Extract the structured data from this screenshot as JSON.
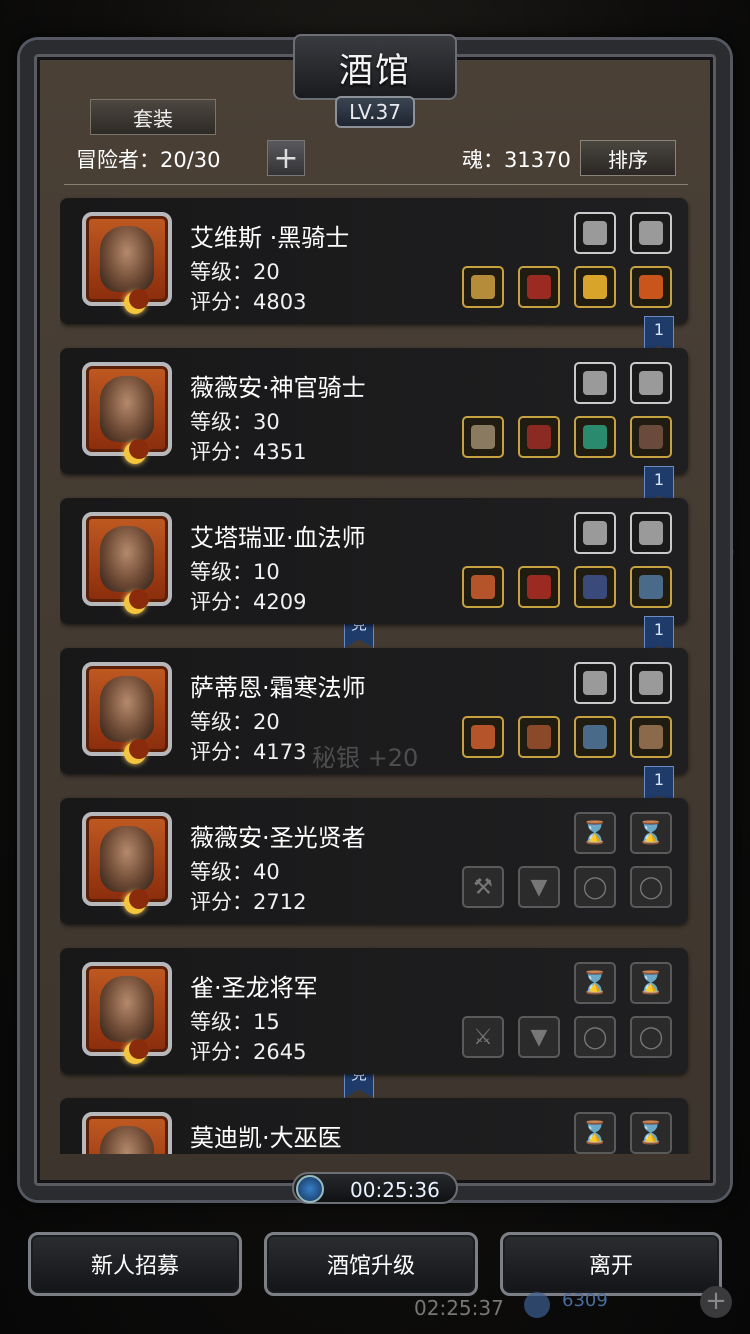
{
  "header": {
    "title": "酒馆",
    "level": "LV.37",
    "set_tab": "套装",
    "adventurers_label": "冒险者：20/30",
    "plus_glyph": "+",
    "soul_label": "魂：31370",
    "sort_label": "排序"
  },
  "heroes": [
    {
      "name": "艾维斯 ·黑骑士",
      "level": "等级：20",
      "score": "评分：4803",
      "top_slots": [
        {
          "type": "eq",
          "icon": "bracer-icon"
        },
        {
          "type": "eq",
          "icon": "bracer-icon"
        }
      ],
      "bottom_slots": [
        {
          "type": "gold",
          "icon": "crossbow-icon",
          "color": "#b58d3a"
        },
        {
          "type": "gold",
          "icon": "helmet-icon",
          "color": "#9a2a22"
        },
        {
          "type": "gold",
          "icon": "ring-icon",
          "color": "#d8a52a"
        },
        {
          "type": "gold",
          "icon": "ring-icon",
          "color": "#c9551d"
        }
      ],
      "ribbon": "1"
    },
    {
      "name": "薇薇安·神官骑士",
      "level": "等级：30",
      "score": "评分：4351",
      "top_slots": [
        {
          "type": "eq",
          "icon": "amulet-icon"
        },
        {
          "type": "eq",
          "icon": "mask-icon"
        }
      ],
      "bottom_slots": [
        {
          "type": "gold",
          "icon": "axe-icon",
          "color": "#8a7a60"
        },
        {
          "type": "gold",
          "icon": "armor-icon",
          "color": "#8b2a22"
        },
        {
          "type": "gold",
          "icon": "gem-icon",
          "color": "#2a8a6e"
        },
        {
          "type": "gold",
          "icon": "cloak-icon",
          "color": "#6a4a3a"
        }
      ],
      "ribbon": "1",
      "badge": "竞"
    },
    {
      "name": "艾塔瑞亚·血法师",
      "level": "等级：10",
      "score": "评分：4209",
      "top_slots": [
        {
          "type": "eq",
          "icon": "book-icon"
        },
        {
          "type": "eq",
          "icon": "wand-icon"
        }
      ],
      "bottom_slots": [
        {
          "type": "gold",
          "icon": "staff-icon",
          "color": "#b5532a"
        },
        {
          "type": "gold",
          "icon": "helmet-icon",
          "color": "#9a2a22"
        },
        {
          "type": "gold",
          "icon": "amulet-icon",
          "color": "#3a4a7a"
        },
        {
          "type": "gold",
          "icon": "armor-icon",
          "color": "#4a6a8a"
        }
      ],
      "ribbon": "1"
    },
    {
      "name": "萨蒂恩·霜寒法师",
      "level": "等级：20",
      "score": "评分：4173",
      "top_slots": [
        {
          "type": "eq",
          "icon": "shield-icon"
        },
        {
          "type": "eq",
          "icon": "horn-icon"
        }
      ],
      "bottom_slots": [
        {
          "type": "gold",
          "icon": "staff-icon",
          "color": "#b5532a"
        },
        {
          "type": "gold",
          "icon": "robe-icon",
          "color": "#8a4a2a"
        },
        {
          "type": "gold",
          "icon": "armor-icon",
          "color": "#4a6a8a"
        },
        {
          "type": "gold",
          "icon": "gauntlet-icon",
          "color": "#8a6a4a"
        }
      ],
      "ribbon": "1"
    },
    {
      "name": "薇薇安·圣光贤者",
      "level": "等级：40",
      "score": "评分：2712",
      "top_slots": [
        {
          "type": "empty",
          "icon": "hourglass-icon"
        },
        {
          "type": "empty",
          "icon": "hourglass-icon"
        }
      ],
      "bottom_slots": [
        {
          "type": "empty",
          "icon": "hammer-icon"
        },
        {
          "type": "empty",
          "icon": "armor-icon"
        },
        {
          "type": "empty",
          "icon": "ring-icon"
        },
        {
          "type": "empty",
          "icon": "ring-icon"
        }
      ],
      "badge": "竞"
    },
    {
      "name": "雀·圣龙将军",
      "level": "等级：15",
      "score": "评分：2645",
      "top_slots": [
        {
          "type": "empty",
          "icon": "hourglass-icon"
        },
        {
          "type": "empty",
          "icon": "hourglass-icon"
        }
      ],
      "bottom_slots": [
        {
          "type": "empty",
          "icon": "sword-icon"
        },
        {
          "type": "empty",
          "icon": "armor-icon"
        },
        {
          "type": "empty",
          "icon": "ring-icon"
        },
        {
          "type": "empty",
          "icon": "ring-icon"
        }
      ]
    },
    {
      "name": "莫迪凯·大巫医",
      "level": "",
      "score": "",
      "top_slots": [
        {
          "type": "empty",
          "icon": "hourglass-icon"
        },
        {
          "type": "empty",
          "icon": "hourglass-icon"
        }
      ],
      "bottom_slots": []
    }
  ],
  "faint_overlay": "秘银 +20",
  "timer": "00:25:36",
  "buttons": {
    "recruit": "新人招募",
    "upgrade": "酒馆升级",
    "leave": "离开"
  },
  "underlay": {
    "time": "02:25:37",
    "gold": "6309",
    "plus": "+"
  }
}
